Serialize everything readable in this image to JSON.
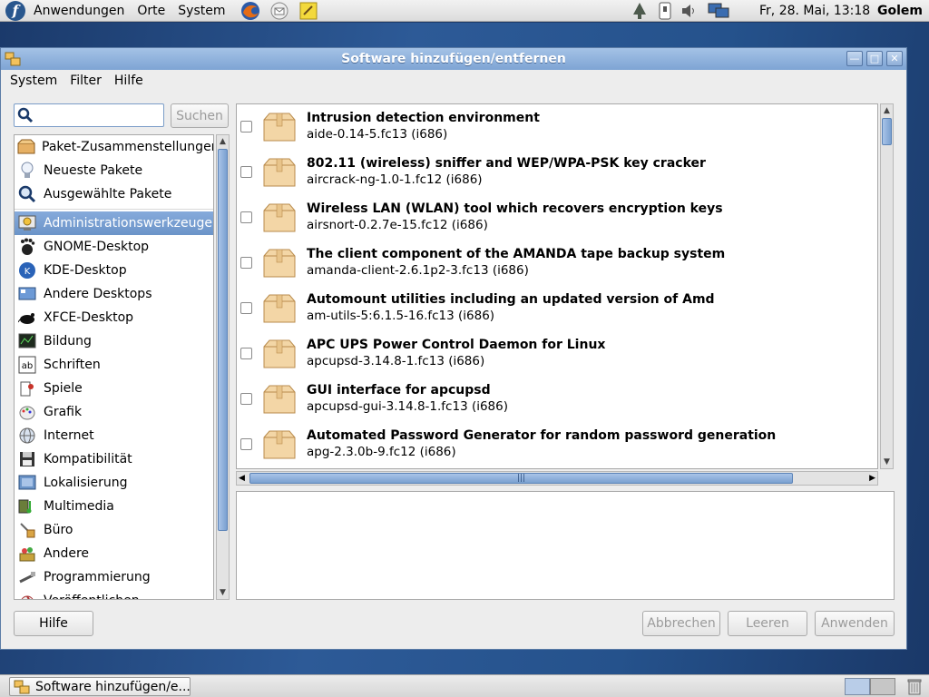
{
  "top_panel": {
    "menus": [
      "Anwendungen",
      "Orte",
      "System"
    ],
    "clock": "Fr, 28. Mai, 13:18",
    "user": "Golem"
  },
  "window": {
    "title": "Software hinzufügen/entfernen",
    "menus": [
      "System",
      "Filter",
      "Hilfe"
    ]
  },
  "search": {
    "value": "",
    "button_label": "Suchen"
  },
  "groups_top": [
    {
      "label": "Paket-Zusammenstellungen",
      "icon": "package-collections-icon"
    },
    {
      "label": "Neueste Pakete",
      "icon": "lightbulb-icon"
    },
    {
      "label": "Ausgewählte Pakete",
      "icon": "magnifier-icon"
    }
  ],
  "groups": [
    {
      "label": "Administrationswerkzeuge",
      "icon": "admin-tools-icon",
      "selected": true
    },
    {
      "label": "GNOME-Desktop",
      "icon": "gnome-foot-icon"
    },
    {
      "label": "KDE-Desktop",
      "icon": "kde-icon"
    },
    {
      "label": "Andere Desktops",
      "icon": "desktop-icon"
    },
    {
      "label": "XFCE-Desktop",
      "icon": "xfce-mouse-icon"
    },
    {
      "label": "Bildung",
      "icon": "education-icon"
    },
    {
      "label": "Schriften",
      "icon": "fonts-icon"
    },
    {
      "label": "Spiele",
      "icon": "games-icon"
    },
    {
      "label": "Grafik",
      "icon": "graphics-icon"
    },
    {
      "label": "Internet",
      "icon": "globe-icon"
    },
    {
      "label": "Kompatibilität",
      "icon": "floppy-icon"
    },
    {
      "label": "Lokalisierung",
      "icon": "localization-icon"
    },
    {
      "label": "Multimedia",
      "icon": "multimedia-icon"
    },
    {
      "label": "Büro",
      "icon": "office-icon"
    },
    {
      "label": "Andere",
      "icon": "other-icon"
    },
    {
      "label": "Programmierung",
      "icon": "programming-icon"
    },
    {
      "label": "Veröffentlichen",
      "icon": "publishing-icon"
    }
  ],
  "packages": [
    {
      "summary": "Intrusion detection environment",
      "version": "aide-0.14-5.fc13 (i686)",
      "checked": false
    },
    {
      "summary": "802.11 (wireless) sniffer and WEP/WPA-PSK key cracker",
      "version": "aircrack-ng-1.0-1.fc12 (i686)",
      "checked": false
    },
    {
      "summary": "Wireless LAN (WLAN) tool which recovers encryption keys",
      "version": "airsnort-0.2.7e-15.fc12 (i686)",
      "checked": false
    },
    {
      "summary": "The client component of the AMANDA tape backup system",
      "version": "amanda-client-2.6.1p2-3.fc13 (i686)",
      "checked": false
    },
    {
      "summary": "Automount utilities including an updated version of Amd",
      "version": "am-utils-5:6.1.5-16.fc13 (i686)",
      "checked": false
    },
    {
      "summary": "APC UPS Power Control Daemon for Linux",
      "version": "apcupsd-3.14.8-1.fc13 (i686)",
      "checked": false
    },
    {
      "summary": "GUI interface for apcupsd",
      "version": "apcupsd-gui-3.14.8-1.fc13 (i686)",
      "checked": false
    },
    {
      "summary": "Automated Password Generator for random password generation",
      "version": "apg-2.3.0b-9.fc12 (i686)",
      "checked": false
    }
  ],
  "buttons": {
    "help": "Hilfe",
    "cancel": "Abbrechen",
    "clear": "Leeren",
    "apply": "Anwenden"
  },
  "taskbar": {
    "item": "Software hinzufügen/e..."
  },
  "colors": {
    "selection": "#7aa0d0",
    "titlebar": "#8fb0db",
    "desktop": "#25528c"
  }
}
